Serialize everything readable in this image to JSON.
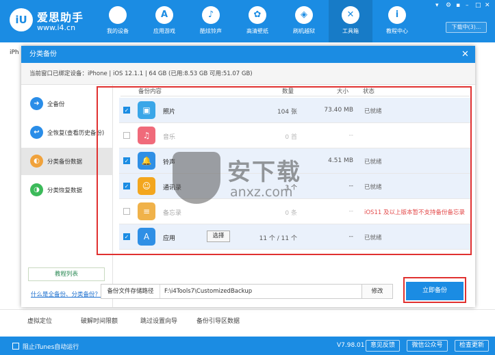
{
  "app": {
    "logo_text": "iU",
    "title": "爱思助手",
    "url": "www.i4.cn",
    "window_controls": [
      "▾",
      "⚙",
      "▪",
      "–",
      "□",
      "✕"
    ],
    "download_label": "下载中(3)..."
  },
  "nav": [
    {
      "label": "我的设备",
      "icon": "apple-icon",
      "glyph": ""
    },
    {
      "label": "应用游戏",
      "icon": "app-store-icon",
      "glyph": "A"
    },
    {
      "label": "酷炫铃声",
      "icon": "bell-icon",
      "glyph": "♪"
    },
    {
      "label": "高清壁纸",
      "icon": "flower-icon",
      "glyph": "✿"
    },
    {
      "label": "刷机越狱",
      "icon": "dropbox-icon",
      "glyph": "◈"
    },
    {
      "label": "工具箱",
      "icon": "tools-icon",
      "glyph": "✕"
    },
    {
      "label": "教程中心",
      "icon": "info-icon",
      "glyph": "i"
    }
  ],
  "background": {
    "tab": "iPh",
    "bottom_items": [
      "虚拟定位",
      "破解时间限额",
      "跳过设置向导",
      "备份引导区数据"
    ]
  },
  "footer": {
    "itunes_label": "阻止iTunes自动运行",
    "version": "V7.98.01",
    "buttons": [
      "意见反馈",
      "微信公众号",
      "检查更新"
    ]
  },
  "dialog": {
    "title": "分类备份",
    "close": "✕",
    "device_info": "当前窗口已绑定设备：iPhone  |  iOS 12.1.1  |  64 GB (已用:8.53 GB 可用:51.07 GB)",
    "sidebar": [
      {
        "label": "全备份",
        "icon": "arrow-right-icon",
        "color": "#2a8de8",
        "glyph": "➜",
        "active": false
      },
      {
        "label": "全恢复(查看历史备份)",
        "icon": "arrow-left-icon",
        "color": "#2a8de8",
        "glyph": "↩",
        "active": false
      },
      {
        "label": "分类备份数据",
        "icon": "category-backup-icon",
        "color": "#f0a23c",
        "glyph": "◐",
        "active": true
      },
      {
        "label": "分类恢复数据",
        "icon": "category-restore-icon",
        "color": "#3cba5a",
        "glyph": "◑",
        "active": false
      }
    ],
    "tutorial_label": "教程列表",
    "what_link": "什么是全备份、分类备份？",
    "columns": {
      "content": "备份内容",
      "count": "数量",
      "size": "大小",
      "status": "状态"
    },
    "rows": [
      {
        "name": "照片",
        "count": "104 张",
        "size": "73.40 MB",
        "status": "已就绪",
        "checked": true,
        "on": true,
        "icon": "photos-icon",
        "color": "#3aa6e8",
        "glyph": "▣",
        "warn": false
      },
      {
        "name": "音乐",
        "count": "0 首",
        "size": "--",
        "status": "",
        "checked": false,
        "on": false,
        "icon": "music-icon",
        "color": "#f06a7a",
        "glyph": "♫",
        "warn": false
      },
      {
        "name": "铃声",
        "count": "",
        "size": "4.51 MB",
        "status": "已就绪",
        "checked": true,
        "on": true,
        "icon": "bell-icon",
        "color": "#2f8fe5",
        "glyph": "🔔",
        "warn": false
      },
      {
        "name": "通讯录",
        "count": "3 个",
        "size": "--",
        "status": "已就绪",
        "checked": true,
        "on": true,
        "icon": "contacts-icon",
        "color": "#f3a61e",
        "glyph": "☺",
        "warn": false
      },
      {
        "name": "备忘录",
        "count": "0 条",
        "size": "--",
        "status": "iOS11 及以上版本暂不支持备份备忘录",
        "checked": false,
        "on": false,
        "icon": "notes-icon",
        "color": "#f0b24a",
        "glyph": "≡",
        "warn": true
      },
      {
        "name": "应用",
        "count": "11 个 / 11 个",
        "size": "--",
        "status": "已就绪",
        "checked": true,
        "on": true,
        "icon": "app-store-icon",
        "color": "#2f8fe5",
        "glyph": "A",
        "warn": false,
        "choose_label": "选择"
      }
    ],
    "path_label": "备份文件存储路径",
    "path_value": "F:\\i4Tools7\\CustomizedBackup",
    "modify_label": "修改",
    "backup_label": "立即备份"
  },
  "watermark": {
    "text": "安下载",
    "sub": "anxz.com"
  }
}
